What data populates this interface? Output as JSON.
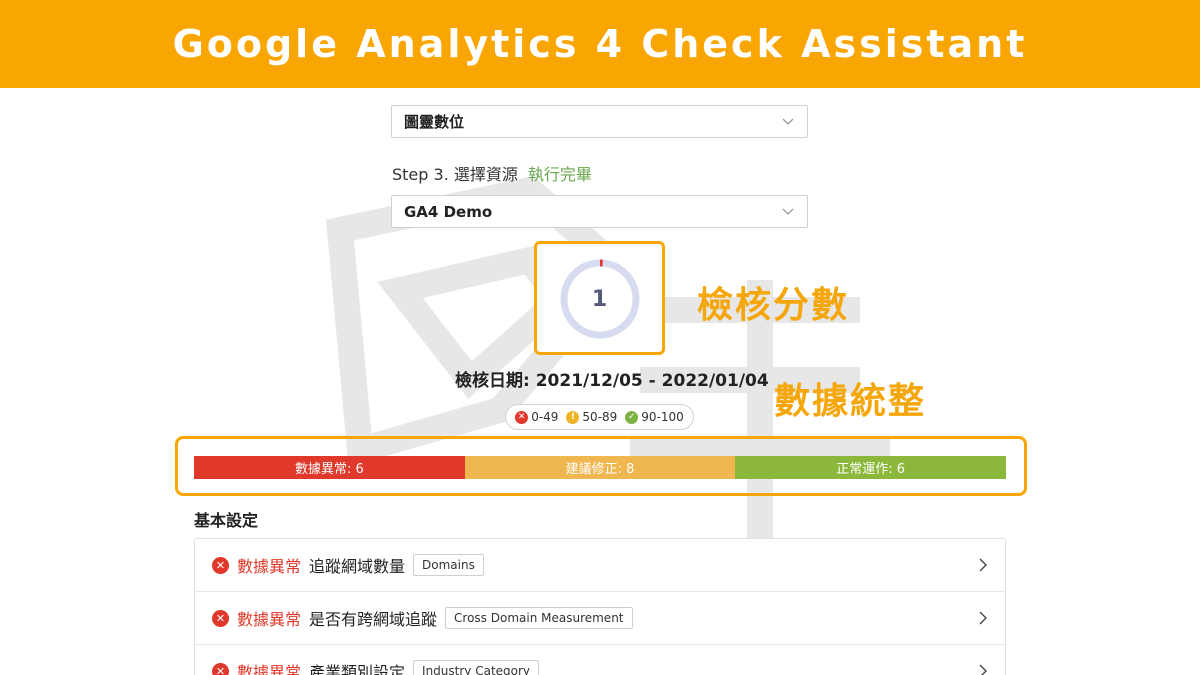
{
  "banner": {
    "title": "Google Analytics 4 Check Assistant"
  },
  "account_select": {
    "value": "圖靈數位"
  },
  "step3": {
    "label": "Step 3. 選擇資源",
    "status": "執行完畢"
  },
  "property_select": {
    "value": "GA4 Demo"
  },
  "score": {
    "value": "1",
    "ring_fraction": 0.01
  },
  "annotations": {
    "score_label": "檢核分數",
    "data_label": "數據統整"
  },
  "check_date": "檢核日期: 2021/12/05 - 2022/01/04",
  "legend": [
    {
      "icon": "error-icon",
      "range": "0-49",
      "color": "#e0392b"
    },
    {
      "icon": "warning-icon",
      "range": "50-89",
      "color": "#f0b429"
    },
    {
      "icon": "check-icon",
      "range": "90-100",
      "color": "#7cb342"
    }
  ],
  "summary": [
    {
      "label": "數據異常: 6",
      "color": "#e0392b"
    },
    {
      "label": "建議修正: 8",
      "color": "#f0b750"
    },
    {
      "label": "正常運作: 6",
      "color": "#8bb83a"
    }
  ],
  "section": {
    "title": "基本設定"
  },
  "items": [
    {
      "status": "數據異常",
      "title": "追蹤網域數量",
      "tag": "Domains"
    },
    {
      "status": "數據異常",
      "title": "是否有跨網域追蹤",
      "tag": "Cross Domain Measurement"
    },
    {
      "status": "數據異常",
      "title": "產業類別設定",
      "tag": "Industry Category"
    }
  ],
  "colors": {
    "accent": "#f9a602",
    "error": "#e0392b",
    "ok": "#6aa84f"
  }
}
